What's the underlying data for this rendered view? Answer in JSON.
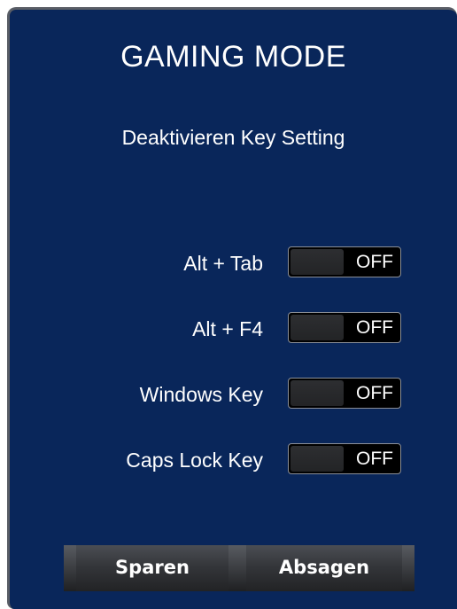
{
  "dialog": {
    "title": "GAMING MODE",
    "subtitle": "Deaktivieren Key Setting"
  },
  "settings": [
    {
      "label": "Alt + Tab",
      "state": "OFF"
    },
    {
      "label": "Alt + F4",
      "state": "OFF"
    },
    {
      "label": "Windows Key",
      "state": "OFF"
    },
    {
      "label": "Caps Lock Key",
      "state": "OFF"
    }
  ],
  "buttons": {
    "save": "Sparen",
    "cancel": "Absagen"
  },
  "colors": {
    "panel_background": "#09265a",
    "panel_border": "#5a5e66",
    "toggle_background": "#000000",
    "button_gradient_top": "#4b4e54",
    "button_gradient_bottom": "#222325",
    "text": "#ffffff"
  }
}
